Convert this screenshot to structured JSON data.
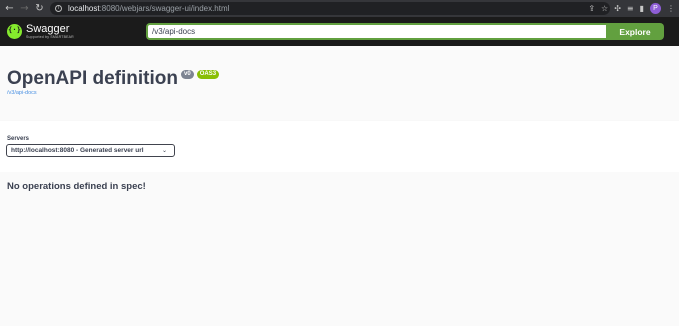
{
  "browser": {
    "back": "←",
    "forward": "→",
    "reload": "↻",
    "url_host": "localhost",
    "url_rest": ":8080/webjars/swagger-ui/index.html",
    "profile_initial": "P"
  },
  "topbar": {
    "logo_name": "Swagger",
    "logo_sub": "Supported by SMARTBEAR",
    "explore_value": "/v3/api-docs",
    "explore_label": "Explore"
  },
  "info": {
    "title": "OpenAPI definition",
    "version_badge": "v0",
    "oas_badge": "OAS3",
    "spec_link": "/v3/api-docs"
  },
  "servers": {
    "label": "Servers",
    "selected": "http://localhost:8080 - Generated server url"
  },
  "content": {
    "message": "No operations defined in spec!"
  },
  "colors": {
    "topbar_bg": "#1b1b1b",
    "swagger_green": "#62a03f",
    "oas_green": "#89bf04",
    "text": "#3b4151",
    "link": "#4990e2"
  }
}
